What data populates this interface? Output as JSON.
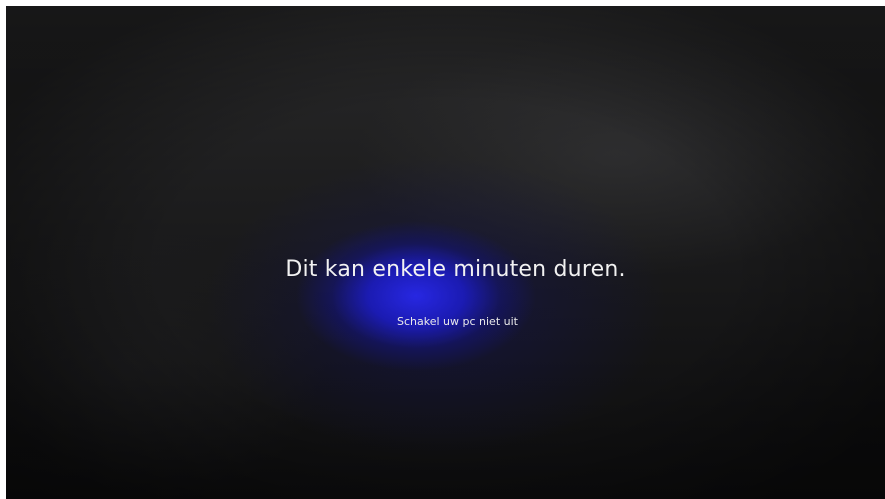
{
  "screen": {
    "title": "Dit kan enkele minuten duren.",
    "subtitle": "Schakel uw pc niet uit",
    "colors": {
      "background": "#1a1a1b",
      "glow": "#2828eb",
      "text": "#f2f2f2"
    }
  }
}
